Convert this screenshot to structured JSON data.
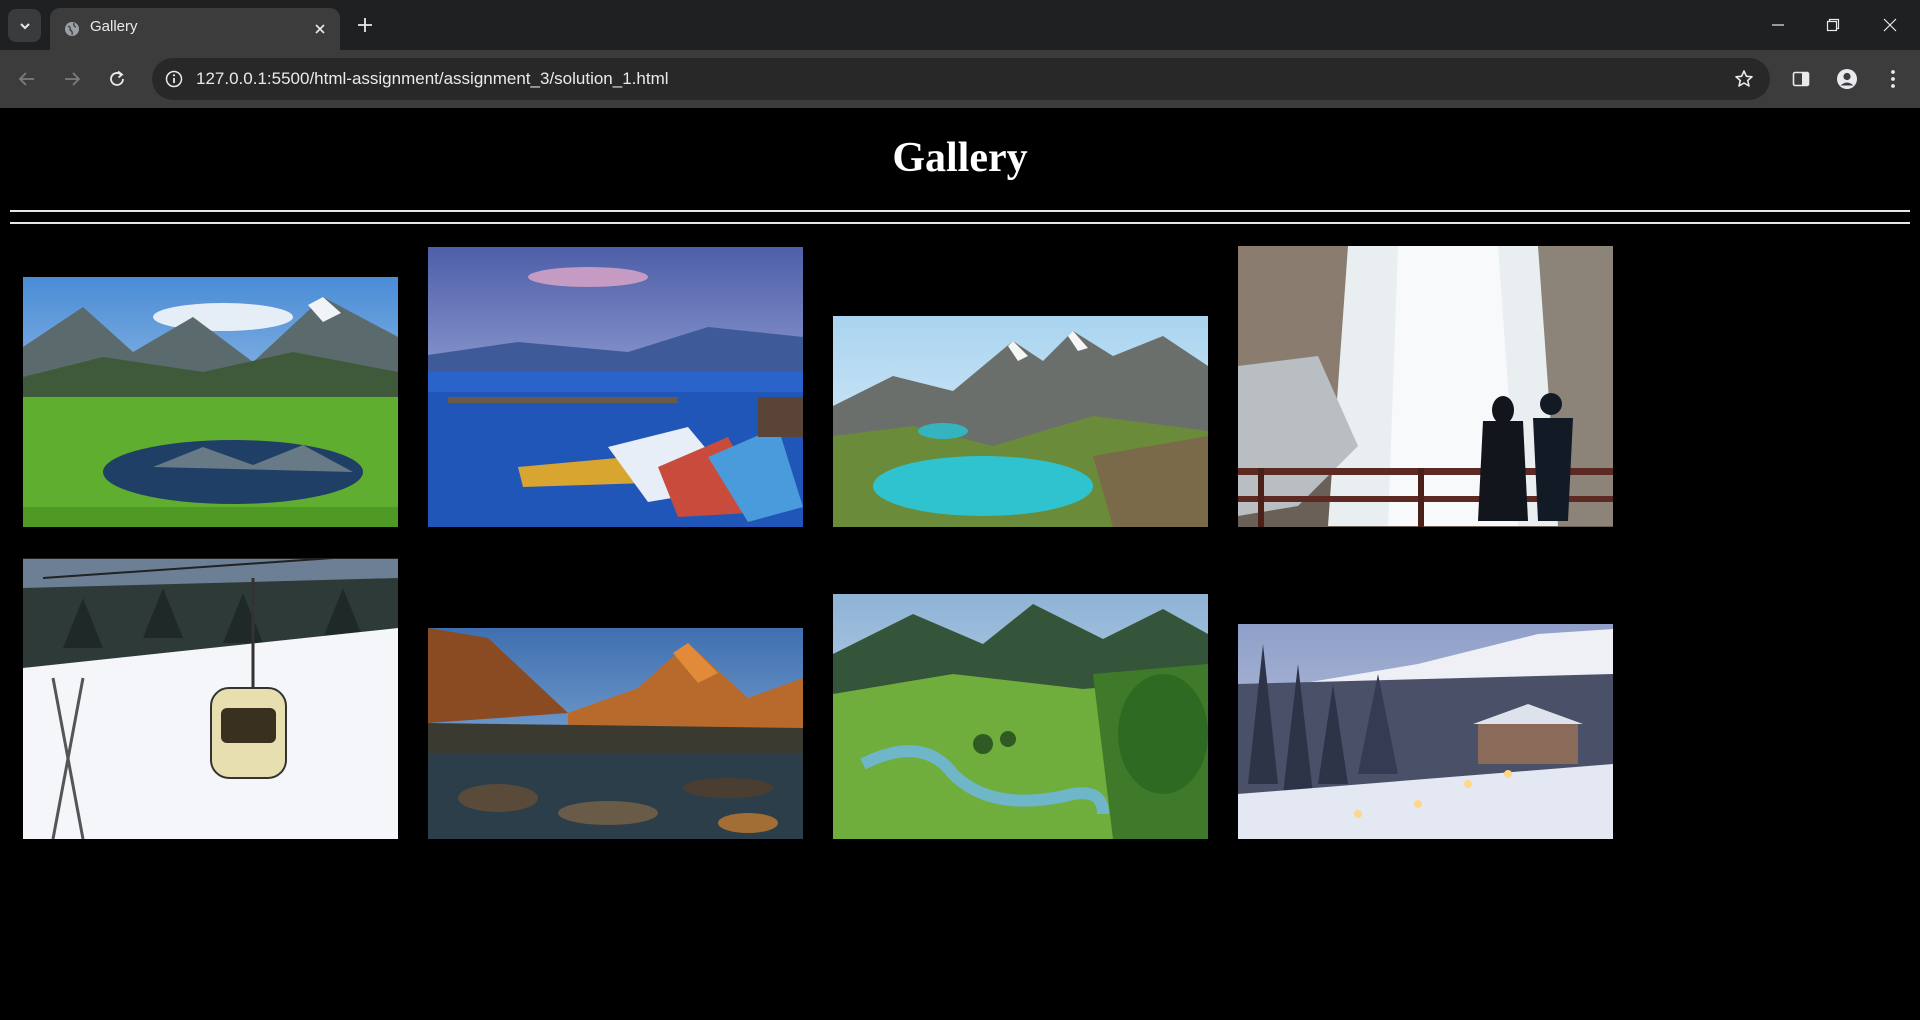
{
  "browser": {
    "tab_title": "Gallery",
    "url": "127.0.0.1:5500/html-assignment/assignment_3/solution_1.html"
  },
  "page": {
    "heading": "Gallery"
  },
  "gallery": [
    {
      "label": "mountain meadow with reflection pond"
    },
    {
      "label": "shikara boats on lake"
    },
    {
      "label": "turquoise alpine lake among peaks"
    },
    {
      "label": "frozen waterfall with two people"
    },
    {
      "label": "cable car over snowy slope"
    },
    {
      "label": "sunset peaks over rocky river"
    },
    {
      "label": "green valley with winding river"
    },
    {
      "label": "snowy forest resort at dusk"
    }
  ]
}
